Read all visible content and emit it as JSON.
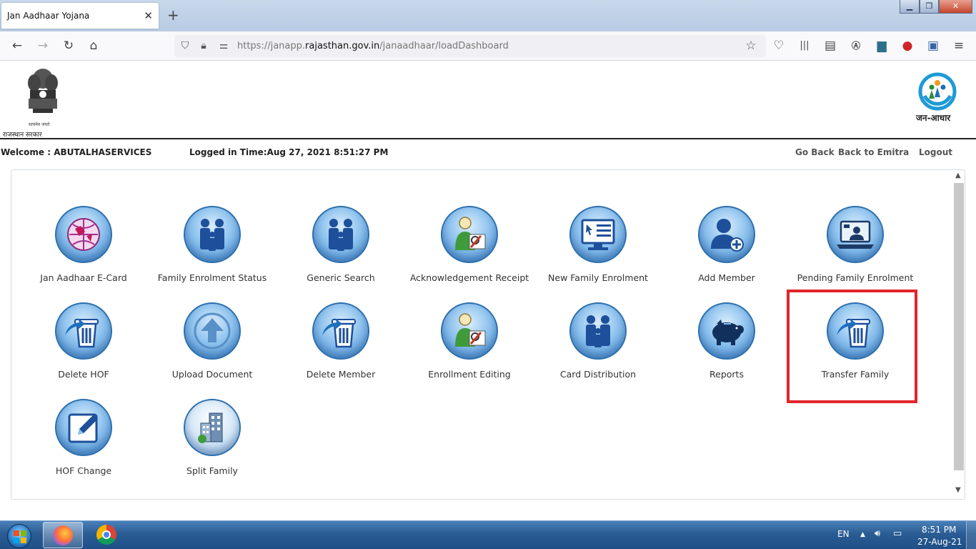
{
  "browser": {
    "tab_title": "Jan Aadhaar Yojana",
    "tab_close": "✕",
    "new_tab": "+",
    "url_prefix": "https://janapp.",
    "url_domain": "rajasthan.gov.in",
    "url_path": "/janaadhaar/loadDashboard",
    "window_min": "▁",
    "window_max": "❐",
    "window_close": "✕"
  },
  "header": {
    "emblem_icon": "ashoka-emblem-icon",
    "emblem_caption": "सत्यमेव जयते",
    "emblem_label": "राजस्थान सरकार",
    "logo_icon": "jan-aadhaar-logo-icon",
    "logo_label": "जन-आधार"
  },
  "infobar": {
    "welcome": "Welcome : ABUTALHASERVICES",
    "logged_in": "Logged in Time:Aug 27, 2021 8:51:27 PM",
    "go_back": "Go Back",
    "back_to_emitra": "Back to Emitra",
    "logout": "Logout"
  },
  "tiles": [
    {
      "label": "Jan Aadhaar E-Card",
      "icon": "globe-card-icon"
    },
    {
      "label": "Family Enrolment Status",
      "icon": "family-icon"
    },
    {
      "label": "Generic Search",
      "icon": "family-icon"
    },
    {
      "label": "Acknowledgement Receipt",
      "icon": "person-document-icon"
    },
    {
      "label": "New Family Enrolment",
      "icon": "monitor-form-icon"
    },
    {
      "label": "Add Member",
      "icon": "add-user-icon"
    },
    {
      "label": "Pending Family Enrolment",
      "icon": "laptop-video-icon"
    },
    {
      "label": "Delete HOF",
      "icon": "trash-arrow-icon"
    },
    {
      "label": "Upload Document",
      "icon": "upload-arrow-icon"
    },
    {
      "label": "Delete Member",
      "icon": "trash-arrow-icon"
    },
    {
      "label": "Enrollment Editing",
      "icon": "person-document-icon"
    },
    {
      "label": "Card Distribution",
      "icon": "family-icon"
    },
    {
      "label": "Reports",
      "icon": "piggy-bank-icon"
    },
    {
      "label": "Transfer Family",
      "icon": "trash-arrow-icon"
    },
    {
      "label": "HOF Change",
      "icon": "edit-pencil-icon"
    },
    {
      "label": "Split Family",
      "icon": "buildings-icon"
    }
  ],
  "highlighted_tile": "Transfer Family",
  "colors": {
    "highlight": "#e2252c",
    "tile_blue": "#3d88cf"
  },
  "taskbar": {
    "language": "EN",
    "time": "8:51 PM",
    "date": "27-Aug-21",
    "apps": [
      "firefox-icon",
      "chrome-icon"
    ]
  }
}
